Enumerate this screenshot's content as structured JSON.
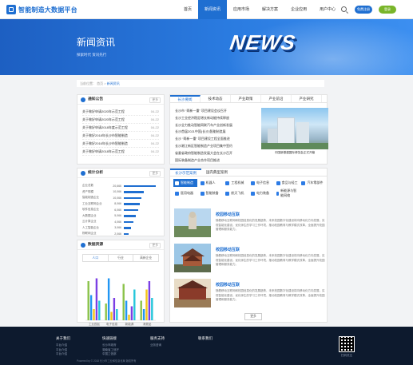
{
  "header": {
    "logo_text": "智能制造大数据平台",
    "nav": [
      "首页",
      "新闻资讯",
      "应用市场",
      "解决方案",
      "企业应用",
      "用户中心"
    ],
    "active_nav": 1,
    "login_label": "免费注册",
    "register_label": "登录"
  },
  "banner": {
    "title": "新闻资讯",
    "subtitle": "探索时代 资讯先行",
    "art_text": "NEWS"
  },
  "breadcrumb": {
    "home": "当前位置：",
    "sep": "首页 >",
    "current": "新闻资讯"
  },
  "notice": {
    "title": "通知公告",
    "more": "更多",
    "items": [
      {
        "text": "关于做好申请2020年示范工程",
        "date": "04-22"
      },
      {
        "text": "关于做好申请2020年示范工程",
        "date": "04-22"
      },
      {
        "text": "关于做好申请2018年度示范工程",
        "date": "04-22"
      },
      {
        "text": "关于做好2018年长沙市智能制造",
        "date": "04-22"
      },
      {
        "text": "关于做好2016年长沙市智能制造",
        "date": "04-22"
      },
      {
        "text": "关于做好申请2018年示范工程",
        "date": "04-22"
      }
    ]
  },
  "stats": {
    "title": "统计分析",
    "more": "更多",
    "rows": [
      {
        "label": "企业总数",
        "value": "20,666",
        "ratio": 1.0
      },
      {
        "label": "资产规模",
        "value": "10,066",
        "ratio": 0.62
      },
      {
        "label": "智能制造企业",
        "value": "10,066",
        "ratio": 0.56
      },
      {
        "label": "工业互联网企业",
        "value": "8,066",
        "ratio": 0.5
      },
      {
        "label": "软件信息企业",
        "value": "6,066",
        "ratio": 0.44
      },
      {
        "label": "大数据企业",
        "value": "5,066",
        "ratio": 0.38
      },
      {
        "label": "云计算企业",
        "value": "4,066",
        "ratio": 0.3
      },
      {
        "label": "人工智能企业",
        "value": "3,066",
        "ratio": 0.22
      },
      {
        "label": "物联网企业",
        "value": "2,066",
        "ratio": 0.16
      }
    ]
  },
  "resources": {
    "title": "数据资源",
    "more": "更多",
    "tabs": [
      "人口",
      "行业",
      "高新企业"
    ],
    "active_tab": 0
  },
  "chart_data": {
    "type": "bar",
    "categories": [
      "工业园区",
      "电子信息",
      "新能源",
      "消费品"
    ],
    "series": [
      {
        "values": [
          28,
          12,
          26,
          14
        ]
      },
      {
        "values": [
          18,
          30,
          14,
          8
        ]
      },
      {
        "values": [
          8,
          6,
          4,
          22
        ]
      },
      {
        "values": [
          30,
          16,
          10,
          28
        ]
      },
      {
        "values": [
          14,
          8,
          22,
          16
        ]
      }
    ],
    "colors": [
      "#8bc34a",
      "#2196f3",
      "#f5c518",
      "#7b3fe4",
      "#26c6da"
    ],
    "ylim": [
      0,
      32
    ]
  },
  "news": {
    "tabs": [
      "长沙要闻",
      "技术动态",
      "产业政策",
      "产业前沿",
      "产业研究"
    ],
    "active_tab": 0,
    "items": [
      "长沙市 “两新一重” 项目建设会议召开",
      "长沙工业经济稳定增长新动能持续释放",
      "长沙全力推动智能网联汽车产业创新发展",
      "长沙首届2021中国(长沙)智能制造展",
      "长沙 “两新一重” 项目建设工程全面推进",
      "长沙湘江新区智能制造产业项目集中签约",
      "省委省政府智能制造发展大会在长沙召开",
      "国际装备制造产业合作项目推进"
    ],
    "image_caption": "中国新基建国际博览会正式开幕"
  },
  "apps": {
    "tabs": [
      "长沙示范案例",
      "国内典型案例"
    ],
    "active_tab": 0,
    "categories": [
      "智能制造",
      "机器人",
      "工程机械",
      "电子信息",
      "食品与轻工",
      "汽车零部件",
      "医用电器",
      "智能装备",
      "航天飞机",
      "电力装备",
      "新能源与智能网络"
    ],
    "active_category": 0,
    "items": [
      {
        "title": "校园移动互联",
        "desc": "随着移动互联网和校园信息化的发展趋势，未来校园数字化建设将向移动化方向发展，实现智能化建设，优化师生的学习工作环境，推动校园教育与教学模式改革，全面提升校园管理和服务能力。"
      },
      {
        "title": "校园移动互联",
        "desc": "随着移动互联网和校园信息化的发展趋势，未来校园数字化建设将向移动化方向发展，实现智能化建设，优化师生的学习工作环境，推动校园教育与教学模式改革，全面提升校园管理和服务能力。"
      },
      {
        "title": "校园移动互联",
        "desc": "随着移动互联网和校园信息化的发展趋势，未来校园数字化建设将向移动化方向发展，实现智能化建设，优化师生的学习工作环境，推动校园教育与教学模式改革，全面提升校园管理和服务能力。"
      }
    ],
    "more_label": "更多"
  },
  "footer": {
    "cols": [
      {
        "head": "关于我们",
        "links": [
          "平台介绍",
          "平台介绍",
          "平台介绍"
        ]
      },
      {
        "head": "快速链接",
        "links": [
          "长沙市政府",
          "湖南省工信厅",
          "中国工信部"
        ]
      },
      {
        "head": "服务支持",
        "links": [
          "业务咨询"
        ]
      },
      {
        "head": "联系我们",
        "links": []
      }
    ],
    "qr_caption": "扫码关注",
    "copyright": "Powered by © 2018 长沙市工业和信息化局  版权所有"
  }
}
